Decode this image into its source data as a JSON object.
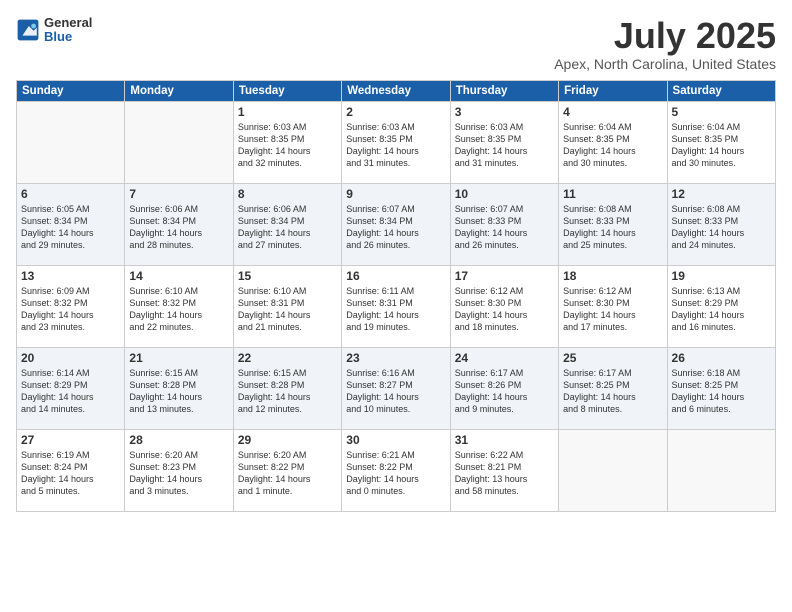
{
  "logo": {
    "general": "General",
    "blue": "Blue"
  },
  "header": {
    "title": "July 2025",
    "subtitle": "Apex, North Carolina, United States"
  },
  "weekdays": [
    "Sunday",
    "Monday",
    "Tuesday",
    "Wednesday",
    "Thursday",
    "Friday",
    "Saturday"
  ],
  "weeks": [
    [
      {
        "day": "",
        "empty": true
      },
      {
        "day": "",
        "empty": true
      },
      {
        "day": "1",
        "info": "Sunrise: 6:03 AM\nSunset: 8:35 PM\nDaylight: 14 hours\nand 32 minutes."
      },
      {
        "day": "2",
        "info": "Sunrise: 6:03 AM\nSunset: 8:35 PM\nDaylight: 14 hours\nand 31 minutes."
      },
      {
        "day": "3",
        "info": "Sunrise: 6:03 AM\nSunset: 8:35 PM\nDaylight: 14 hours\nand 31 minutes."
      },
      {
        "day": "4",
        "info": "Sunrise: 6:04 AM\nSunset: 8:35 PM\nDaylight: 14 hours\nand 30 minutes."
      },
      {
        "day": "5",
        "info": "Sunrise: 6:04 AM\nSunset: 8:35 PM\nDaylight: 14 hours\nand 30 minutes."
      }
    ],
    [
      {
        "day": "6",
        "info": "Sunrise: 6:05 AM\nSunset: 8:34 PM\nDaylight: 14 hours\nand 29 minutes."
      },
      {
        "day": "7",
        "info": "Sunrise: 6:06 AM\nSunset: 8:34 PM\nDaylight: 14 hours\nand 28 minutes."
      },
      {
        "day": "8",
        "info": "Sunrise: 6:06 AM\nSunset: 8:34 PM\nDaylight: 14 hours\nand 27 minutes."
      },
      {
        "day": "9",
        "info": "Sunrise: 6:07 AM\nSunset: 8:34 PM\nDaylight: 14 hours\nand 26 minutes."
      },
      {
        "day": "10",
        "info": "Sunrise: 6:07 AM\nSunset: 8:33 PM\nDaylight: 14 hours\nand 26 minutes."
      },
      {
        "day": "11",
        "info": "Sunrise: 6:08 AM\nSunset: 8:33 PM\nDaylight: 14 hours\nand 25 minutes."
      },
      {
        "day": "12",
        "info": "Sunrise: 6:08 AM\nSunset: 8:33 PM\nDaylight: 14 hours\nand 24 minutes."
      }
    ],
    [
      {
        "day": "13",
        "info": "Sunrise: 6:09 AM\nSunset: 8:32 PM\nDaylight: 14 hours\nand 23 minutes."
      },
      {
        "day": "14",
        "info": "Sunrise: 6:10 AM\nSunset: 8:32 PM\nDaylight: 14 hours\nand 22 minutes."
      },
      {
        "day": "15",
        "info": "Sunrise: 6:10 AM\nSunset: 8:31 PM\nDaylight: 14 hours\nand 21 minutes."
      },
      {
        "day": "16",
        "info": "Sunrise: 6:11 AM\nSunset: 8:31 PM\nDaylight: 14 hours\nand 19 minutes."
      },
      {
        "day": "17",
        "info": "Sunrise: 6:12 AM\nSunset: 8:30 PM\nDaylight: 14 hours\nand 18 minutes."
      },
      {
        "day": "18",
        "info": "Sunrise: 6:12 AM\nSunset: 8:30 PM\nDaylight: 14 hours\nand 17 minutes."
      },
      {
        "day": "19",
        "info": "Sunrise: 6:13 AM\nSunset: 8:29 PM\nDaylight: 14 hours\nand 16 minutes."
      }
    ],
    [
      {
        "day": "20",
        "info": "Sunrise: 6:14 AM\nSunset: 8:29 PM\nDaylight: 14 hours\nand 14 minutes."
      },
      {
        "day": "21",
        "info": "Sunrise: 6:15 AM\nSunset: 8:28 PM\nDaylight: 14 hours\nand 13 minutes."
      },
      {
        "day": "22",
        "info": "Sunrise: 6:15 AM\nSunset: 8:28 PM\nDaylight: 14 hours\nand 12 minutes."
      },
      {
        "day": "23",
        "info": "Sunrise: 6:16 AM\nSunset: 8:27 PM\nDaylight: 14 hours\nand 10 minutes."
      },
      {
        "day": "24",
        "info": "Sunrise: 6:17 AM\nSunset: 8:26 PM\nDaylight: 14 hours\nand 9 minutes."
      },
      {
        "day": "25",
        "info": "Sunrise: 6:17 AM\nSunset: 8:25 PM\nDaylight: 14 hours\nand 8 minutes."
      },
      {
        "day": "26",
        "info": "Sunrise: 6:18 AM\nSunset: 8:25 PM\nDaylight: 14 hours\nand 6 minutes."
      }
    ],
    [
      {
        "day": "27",
        "info": "Sunrise: 6:19 AM\nSunset: 8:24 PM\nDaylight: 14 hours\nand 5 minutes."
      },
      {
        "day": "28",
        "info": "Sunrise: 6:20 AM\nSunset: 8:23 PM\nDaylight: 14 hours\nand 3 minutes."
      },
      {
        "day": "29",
        "info": "Sunrise: 6:20 AM\nSunset: 8:22 PM\nDaylight: 14 hours\nand 1 minute."
      },
      {
        "day": "30",
        "info": "Sunrise: 6:21 AM\nSunset: 8:22 PM\nDaylight: 14 hours\nand 0 minutes."
      },
      {
        "day": "31",
        "info": "Sunrise: 6:22 AM\nSunset: 8:21 PM\nDaylight: 13 hours\nand 58 minutes."
      },
      {
        "day": "",
        "empty": true
      },
      {
        "day": "",
        "empty": true
      }
    ]
  ]
}
